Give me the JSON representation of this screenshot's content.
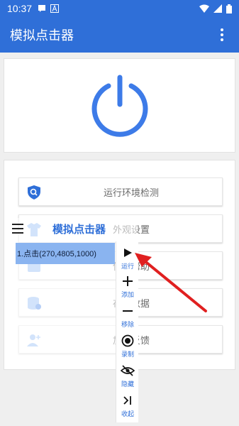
{
  "status_bar": {
    "time": "10:37"
  },
  "app_bar": {
    "title": "模拟点击器"
  },
  "power": {
    "icon": "power-icon"
  },
  "main_buttons": [
    {
      "label": "运行环境检测",
      "icon": "shield-search-icon",
      "color": "#2F6FD8"
    },
    {
      "label": "外观设置",
      "icon": "shirt-icon",
      "color": "#6FA3F0"
    },
    {
      "label": "使用帮助",
      "icon": "help-icon",
      "color": "#6FA3F0"
    },
    {
      "label": "存档数据",
      "icon": "database-icon",
      "color": "#6FA3F0"
    },
    {
      "label": "加群反馈",
      "icon": "add-user-icon",
      "color": "#6FA3F0"
    }
  ],
  "overlay": {
    "title": "模拟点击器",
    "selected_item": "1.点击(270,4805,1000)",
    "tools": [
      {
        "label": "运行",
        "icon": "play-icon"
      },
      {
        "label": "添加",
        "icon": "plus-icon"
      },
      {
        "label": "移除",
        "icon": "minus-icon"
      },
      {
        "label": "录制",
        "icon": "record-icon"
      },
      {
        "label": "隐藏",
        "icon": "eye-off-icon"
      },
      {
        "label": "收起",
        "icon": "collapse-icon"
      }
    ]
  },
  "colors": {
    "primary": "#2F6FD8",
    "annotation_arrow": "#E02020"
  }
}
